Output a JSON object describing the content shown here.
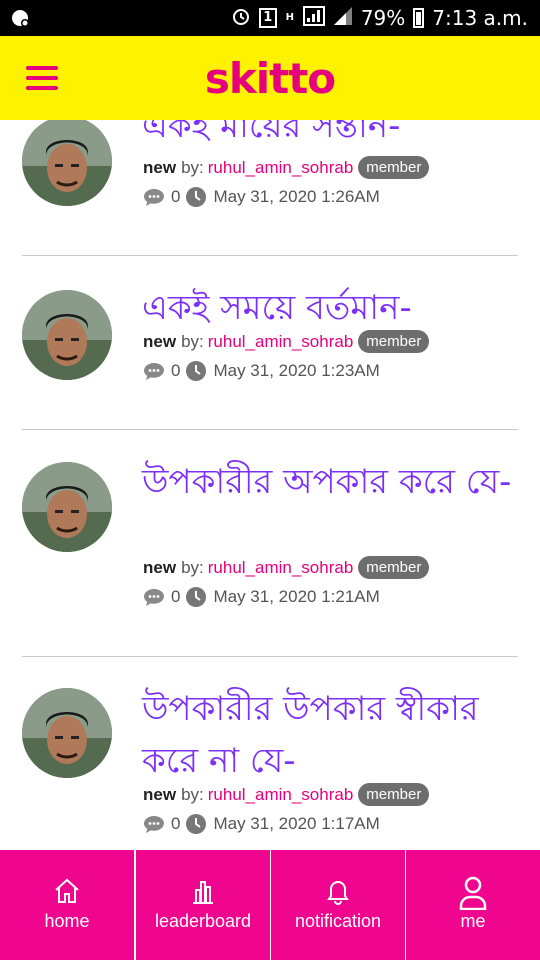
{
  "status_bar": {
    "sim_label": "1",
    "network_label": "H",
    "battery": "79%",
    "time": "7:13 a.m."
  },
  "header": {
    "brand": "skitto",
    "brand_color": "#e6007e",
    "bar_color": "#fff200",
    "menu_icon": "hamburger-menu-icon"
  },
  "posts": [
    {
      "title": "একই মায়ের সন্তান-",
      "status": "new",
      "by_label": "by:",
      "author": "ruhul_amin_sohrab",
      "role": "member",
      "comments": "0",
      "date": "May 31, 2020 1:26AM"
    },
    {
      "title": "একই সময়ে বর্তমান-",
      "status": "new",
      "by_label": "by:",
      "author": "ruhul_amin_sohrab",
      "role": "member",
      "comments": "0",
      "date": "May 31, 2020 1:23AM"
    },
    {
      "title": "উপকারীর অপকার করে যে-",
      "status": "new",
      "by_label": "by:",
      "author": "ruhul_amin_sohrab",
      "role": "member",
      "comments": "0",
      "date": "May 31, 2020 1:21AM"
    },
    {
      "title": "উপকারীর উপকার স্বীকার করে না যে-",
      "status": "new",
      "by_label": "by:",
      "author": "ruhul_amin_sohrab",
      "role": "member",
      "comments": "0",
      "date": "May 31, 2020 1:17AM"
    }
  ],
  "nav": {
    "color": "#f0058f",
    "items": [
      {
        "label": "home",
        "icon": "home-icon"
      },
      {
        "label": "leaderboard",
        "icon": "bar-chart-icon"
      },
      {
        "label": "notification",
        "icon": "bell-icon"
      },
      {
        "label": "me",
        "icon": "user-icon"
      }
    ]
  }
}
